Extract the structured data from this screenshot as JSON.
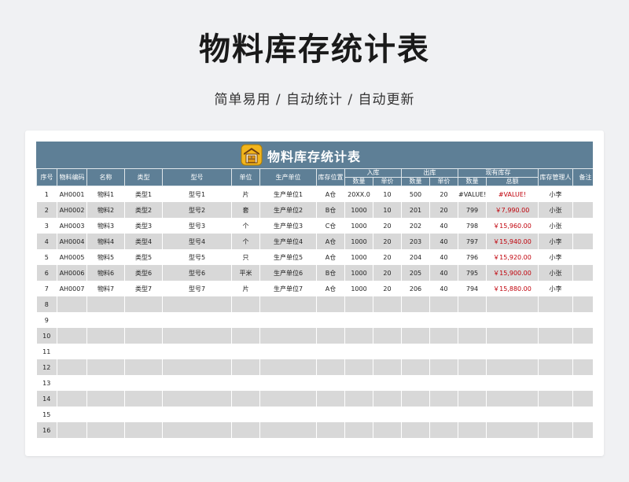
{
  "page": {
    "title": "物料库存统计表",
    "subtitle": "简单易用 / 自动统计 / 自动更新"
  },
  "sheet": {
    "title": "物料库存统计表",
    "headers": {
      "seq": "序号",
      "code": "物料编码",
      "name": "名称",
      "type": "类型",
      "model": "型号",
      "unit": "单位",
      "producer": "生产单位",
      "location": "库存位置",
      "in": "入库",
      "out": "出库",
      "stock": "现有库存",
      "in_qty": "数量",
      "in_price": "单价",
      "out_qty": "数量",
      "out_price": "单价",
      "stock_qty": "数量",
      "stock_total": "总额",
      "manager": "库存管理人",
      "note": "备注"
    },
    "rows": [
      {
        "seq": "1",
        "code": "AH0001",
        "name": "物料1",
        "type": "类型1",
        "model": "型号1",
        "unit": "片",
        "producer": "生产单位1",
        "location": "A仓",
        "in_qty": "20XX.0",
        "in_price": "10",
        "out_qty": "500",
        "out_price": "20",
        "stock_qty": "#VALUE!",
        "stock_total": "#VALUE!",
        "manager": "小李",
        "note": ""
      },
      {
        "seq": "2",
        "code": "AH0002",
        "name": "物料2",
        "type": "类型2",
        "model": "型号2",
        "unit": "套",
        "producer": "生产单位2",
        "location": "B仓",
        "in_qty": "1000",
        "in_price": "10",
        "out_qty": "201",
        "out_price": "20",
        "stock_qty": "799",
        "stock_total": "￥7,990.00",
        "manager": "小张",
        "note": ""
      },
      {
        "seq": "3",
        "code": "AH0003",
        "name": "物料3",
        "type": "类型3",
        "model": "型号3",
        "unit": "个",
        "producer": "生产单位3",
        "location": "C仓",
        "in_qty": "1000",
        "in_price": "20",
        "out_qty": "202",
        "out_price": "40",
        "stock_qty": "798",
        "stock_total": "￥15,960.00",
        "manager": "小张",
        "note": ""
      },
      {
        "seq": "4",
        "code": "AH0004",
        "name": "物料4",
        "type": "类型4",
        "model": "型号4",
        "unit": "个",
        "producer": "生产单位4",
        "location": "A仓",
        "in_qty": "1000",
        "in_price": "20",
        "out_qty": "203",
        "out_price": "40",
        "stock_qty": "797",
        "stock_total": "￥15,940.00",
        "manager": "小李",
        "note": ""
      },
      {
        "seq": "5",
        "code": "AH0005",
        "name": "物料5",
        "type": "类型5",
        "model": "型号5",
        "unit": "只",
        "producer": "生产单位5",
        "location": "A仓",
        "in_qty": "1000",
        "in_price": "20",
        "out_qty": "204",
        "out_price": "40",
        "stock_qty": "796",
        "stock_total": "￥15,920.00",
        "manager": "小李",
        "note": ""
      },
      {
        "seq": "6",
        "code": "AH0006",
        "name": "物料6",
        "type": "类型6",
        "model": "型号6",
        "unit": "平米",
        "producer": "生产单位6",
        "location": "B仓",
        "in_qty": "1000",
        "in_price": "20",
        "out_qty": "205",
        "out_price": "40",
        "stock_qty": "795",
        "stock_total": "￥15,900.00",
        "manager": "小张",
        "note": ""
      },
      {
        "seq": "7",
        "code": "AH0007",
        "name": "物料7",
        "type": "类型7",
        "model": "型号7",
        "unit": "片",
        "producer": "生产单位7",
        "location": "A仓",
        "in_qty": "1000",
        "in_price": "20",
        "out_qty": "206",
        "out_price": "40",
        "stock_qty": "794",
        "stock_total": "￥15,880.00",
        "manager": "小李",
        "note": ""
      },
      {
        "seq": "8",
        "code": "",
        "name": "",
        "type": "",
        "model": "",
        "unit": "",
        "producer": "",
        "location": "",
        "in_qty": "",
        "in_price": "",
        "out_qty": "",
        "out_price": "",
        "stock_qty": "",
        "stock_total": "",
        "manager": "",
        "note": ""
      },
      {
        "seq": "9",
        "code": "",
        "name": "",
        "type": "",
        "model": "",
        "unit": "",
        "producer": "",
        "location": "",
        "in_qty": "",
        "in_price": "",
        "out_qty": "",
        "out_price": "",
        "stock_qty": "",
        "stock_total": "",
        "manager": "",
        "note": ""
      },
      {
        "seq": "10",
        "code": "",
        "name": "",
        "type": "",
        "model": "",
        "unit": "",
        "producer": "",
        "location": "",
        "in_qty": "",
        "in_price": "",
        "out_qty": "",
        "out_price": "",
        "stock_qty": "",
        "stock_total": "",
        "manager": "",
        "note": ""
      },
      {
        "seq": "11",
        "code": "",
        "name": "",
        "type": "",
        "model": "",
        "unit": "",
        "producer": "",
        "location": "",
        "in_qty": "",
        "in_price": "",
        "out_qty": "",
        "out_price": "",
        "stock_qty": "",
        "stock_total": "",
        "manager": "",
        "note": ""
      },
      {
        "seq": "12",
        "code": "",
        "name": "",
        "type": "",
        "model": "",
        "unit": "",
        "producer": "",
        "location": "",
        "in_qty": "",
        "in_price": "",
        "out_qty": "",
        "out_price": "",
        "stock_qty": "",
        "stock_total": "",
        "manager": "",
        "note": ""
      },
      {
        "seq": "13",
        "code": "",
        "name": "",
        "type": "",
        "model": "",
        "unit": "",
        "producer": "",
        "location": "",
        "in_qty": "",
        "in_price": "",
        "out_qty": "",
        "out_price": "",
        "stock_qty": "",
        "stock_total": "",
        "manager": "",
        "note": ""
      },
      {
        "seq": "14",
        "code": "",
        "name": "",
        "type": "",
        "model": "",
        "unit": "",
        "producer": "",
        "location": "",
        "in_qty": "",
        "in_price": "",
        "out_qty": "",
        "out_price": "",
        "stock_qty": "",
        "stock_total": "",
        "manager": "",
        "note": ""
      },
      {
        "seq": "15",
        "code": "",
        "name": "",
        "type": "",
        "model": "",
        "unit": "",
        "producer": "",
        "location": "",
        "in_qty": "",
        "in_price": "",
        "out_qty": "",
        "out_price": "",
        "stock_qty": "",
        "stock_total": "",
        "manager": "",
        "note": ""
      },
      {
        "seq": "16",
        "code": "",
        "name": "",
        "type": "",
        "model": "",
        "unit": "",
        "producer": "",
        "location": "",
        "in_qty": "",
        "in_price": "",
        "out_qty": "",
        "out_price": "",
        "stock_qty": "",
        "stock_total": "",
        "manager": "",
        "note": ""
      }
    ]
  },
  "colors": {
    "header_bg": "#5e7f96",
    "row_alt": "#d8d8d8",
    "money_red": "#c0000a",
    "page_bg": "#f0f1f3"
  },
  "icons": {
    "title_icon": "warehouse-icon"
  }
}
